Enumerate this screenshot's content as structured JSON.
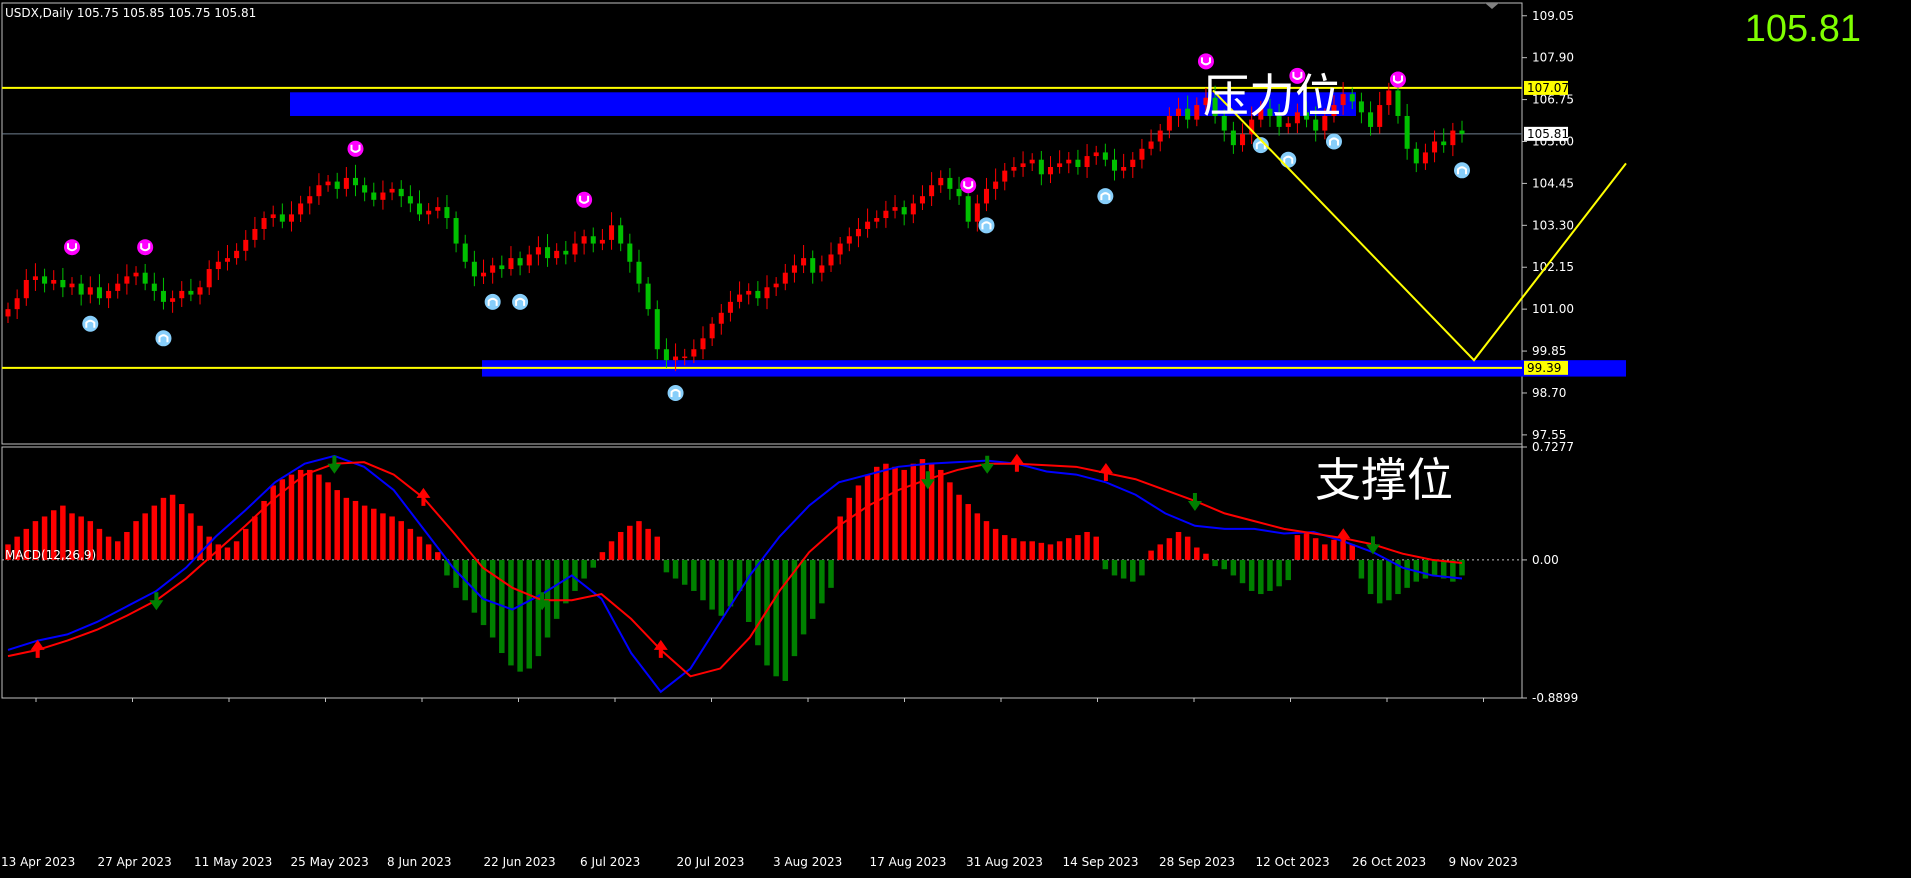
{
  "window": {
    "symbol_header": "USDX,Daily  105.75 105.85 105.75 105.81",
    "big_price": "105.81",
    "macd_header": "MACD(12,26,9)"
  },
  "annotations": {
    "resistance_label": "压力位",
    "support_label": "支撑位"
  },
  "colors": {
    "background": "#000000",
    "bull_candle": "#ff0000",
    "bear_candle": "#00c000",
    "level_line": "#ffff00",
    "zone": "#0000ff",
    "macd_line": "#0000ff",
    "signal_line": "#ff0000",
    "hist_pos": "#ff0000",
    "hist_neg": "#008000",
    "fractal_up": "#ff00ff",
    "fractal_down": "#87cefa",
    "big_price": "#7fff00"
  },
  "chart_data": [
    {
      "type": "candlestick",
      "name": "USDX Daily",
      "ylim": [
        97.3,
        109.4
      ],
      "y_ticks": [
        "109.05",
        "107.90",
        "106.75",
        "105.60",
        "104.45",
        "103.30",
        "102.15",
        "101.00",
        "99.85",
        "98.70",
        "97.55"
      ],
      "x_ticks": [
        "13 Apr 2023",
        "27 Apr 2023",
        "11 May 2023",
        "25 May 2023",
        "8 Jun 2023",
        "22 Jun 2023",
        "6 Jul 2023",
        "20 Jul 2023",
        "3 Aug 2023",
        "17 Aug 2023",
        "31 Aug 2023",
        "14 Sep 2023",
        "28 Sep 2023",
        "12 Oct 2023",
        "26 Oct 2023",
        "9 Nov 2023"
      ],
      "resistance_level": 107.07,
      "resistance_label_value": "107.07",
      "support_level": 99.39,
      "support_label_value": "99.39",
      "current_price": 105.81,
      "current_price_label": "105.81",
      "resistance_zone": [
        106.3,
        106.95
      ],
      "support_zone": [
        99.15,
        99.6
      ],
      "close_path": [
        101.0,
        101.3,
        101.8,
        101.9,
        101.7,
        101.8,
        101.6,
        101.7,
        101.4,
        101.6,
        101.3,
        101.5,
        101.7,
        101.9,
        102.0,
        101.7,
        101.5,
        101.2,
        101.3,
        101.5,
        101.4,
        101.6,
        102.1,
        102.3,
        102.4,
        102.6,
        102.9,
        103.2,
        103.5,
        103.6,
        103.4,
        103.6,
        103.9,
        104.1,
        104.4,
        104.5,
        104.3,
        104.6,
        104.4,
        104.2,
        104.0,
        104.2,
        104.3,
        104.1,
        103.9,
        103.6,
        103.7,
        103.8,
        103.5,
        102.8,
        102.3,
        101.9,
        102.0,
        102.2,
        102.1,
        102.4,
        102.2,
        102.5,
        102.7,
        102.4,
        102.6,
        102.5,
        102.8,
        103.0,
        102.8,
        102.9,
        103.3,
        102.8,
        102.3,
        101.7,
        101.0,
        99.9,
        99.6,
        99.7,
        99.7,
        99.9,
        100.2,
        100.6,
        100.9,
        101.2,
        101.4,
        101.5,
        101.3,
        101.6,
        101.7,
        102.0,
        102.2,
        102.4,
        102.0,
        102.2,
        102.5,
        102.8,
        103.0,
        103.2,
        103.4,
        103.5,
        103.7,
        103.8,
        103.6,
        103.9,
        104.1,
        104.4,
        104.6,
        104.3,
        104.1,
        103.4,
        103.9,
        104.3,
        104.5,
        104.8,
        104.9,
        105.0,
        105.1,
        104.7,
        104.9,
        105.0,
        105.1,
        104.9,
        105.2,
        105.3,
        105.1,
        104.8,
        104.9,
        105.1,
        105.4,
        105.6,
        105.9,
        106.3,
        106.5,
        106.2,
        106.6,
        106.8,
        106.3,
        105.9,
        105.5,
        105.8,
        106.2,
        106.5,
        106.3,
        106.0,
        106.1,
        106.4,
        106.2,
        105.9,
        106.3,
        106.6,
        106.9,
        106.7,
        106.4,
        106.0,
        106.6,
        107.0,
        106.3,
        105.4,
        105.0,
        105.3,
        105.6,
        105.5,
        105.9,
        105.81
      ],
      "projection_path": [
        {
          "date": "27 Sep 2023",
          "price": 107.0
        },
        {
          "date": "15 Nov 2023",
          "price": 99.6
        },
        {
          "date": "24 Nov 2023",
          "price": 105.0
        }
      ]
    },
    {
      "type": "macd",
      "name": "MACD(12,26,9)",
      "ylim": [
        -0.8899,
        0.7277
      ],
      "y_ticks": [
        "0.7277",
        "0.00",
        "-0.8899"
      ],
      "histogram": [
        0.1,
        0.15,
        0.2,
        0.25,
        0.28,
        0.32,
        0.35,
        0.3,
        0.28,
        0.25,
        0.2,
        0.15,
        0.12,
        0.18,
        0.25,
        0.3,
        0.35,
        0.4,
        0.42,
        0.36,
        0.3,
        0.22,
        0.15,
        0.1,
        0.08,
        0.12,
        0.2,
        0.28,
        0.38,
        0.48,
        0.52,
        0.55,
        0.58,
        0.58,
        0.55,
        0.5,
        0.45,
        0.4,
        0.38,
        0.35,
        0.33,
        0.3,
        0.28,
        0.25,
        0.2,
        0.15,
        0.1,
        0.05,
        -0.1,
        -0.18,
        -0.26,
        -0.34,
        -0.42,
        -0.5,
        -0.6,
        -0.68,
        -0.72,
        -0.7,
        -0.62,
        -0.5,
        -0.38,
        -0.28,
        -0.2,
        -0.12,
        -0.05,
        0.05,
        0.12,
        0.18,
        0.22,
        0.25,
        0.2,
        0.15,
        -0.08,
        -0.12,
        -0.16,
        -0.2,
        -0.26,
        -0.32,
        -0.36,
        -0.3,
        -0.2,
        -0.4,
        -0.55,
        -0.68,
        -0.75,
        -0.78,
        -0.62,
        -0.48,
        -0.38,
        -0.28,
        -0.18,
        0.28,
        0.4,
        0.48,
        0.55,
        0.6,
        0.62,
        0.6,
        0.58,
        0.62,
        0.65,
        0.62,
        0.58,
        0.5,
        0.42,
        0.36,
        0.3,
        0.25,
        0.2,
        0.16,
        0.14,
        0.12,
        0.12,
        0.11,
        0.1,
        0.12,
        0.14,
        0.16,
        0.18,
        0.15,
        -0.06,
        -0.1,
        -0.12,
        -0.14,
        -0.1,
        0.06,
        0.1,
        0.14,
        0.18,
        0.15,
        0.08,
        0.04,
        -0.04,
        -0.06,
        -0.1,
        -0.15,
        -0.2,
        -0.22,
        -0.2,
        -0.17,
        -0.13,
        0.16,
        0.18,
        0.14,
        0.1,
        0.13,
        0.16,
        0.1,
        -0.12,
        -0.22,
        -0.28,
        -0.26,
        -0.22,
        -0.18,
        -0.14,
        -0.12,
        -0.1,
        -0.12,
        -0.14,
        -0.1
      ],
      "macd_line": [
        -0.58,
        -0.52,
        -0.48,
        -0.4,
        -0.3,
        -0.2,
        -0.05,
        0.15,
        0.32,
        0.5,
        0.62,
        0.67,
        0.6,
        0.45,
        0.2,
        -0.05,
        -0.25,
        -0.32,
        -0.22,
        -0.1,
        -0.25,
        -0.6,
        -0.85,
        -0.7,
        -0.4,
        -0.1,
        0.15,
        0.35,
        0.5,
        0.55,
        0.6,
        0.62,
        0.63,
        0.64,
        0.62,
        0.57,
        0.55,
        0.5,
        0.42,
        0.3,
        0.22,
        0.2,
        0.2,
        0.17,
        0.18,
        0.12,
        0.05,
        -0.05,
        -0.1,
        -0.12
      ],
      "signal_line": [
        -0.62,
        -0.58,
        -0.52,
        -0.45,
        -0.36,
        -0.26,
        -0.12,
        0.05,
        0.22,
        0.4,
        0.55,
        0.62,
        0.63,
        0.55,
        0.4,
        0.18,
        -0.05,
        -0.18,
        -0.26,
        -0.26,
        -0.22,
        -0.38,
        -0.58,
        -0.75,
        -0.7,
        -0.5,
        -0.2,
        0.05,
        0.22,
        0.35,
        0.45,
        0.52,
        0.58,
        0.62,
        0.62,
        0.61,
        0.6,
        0.56,
        0.52,
        0.45,
        0.38,
        0.3,
        0.25,
        0.2,
        0.17,
        0.14,
        0.1,
        0.04,
        0.0,
        -0.02
      ]
    }
  ]
}
